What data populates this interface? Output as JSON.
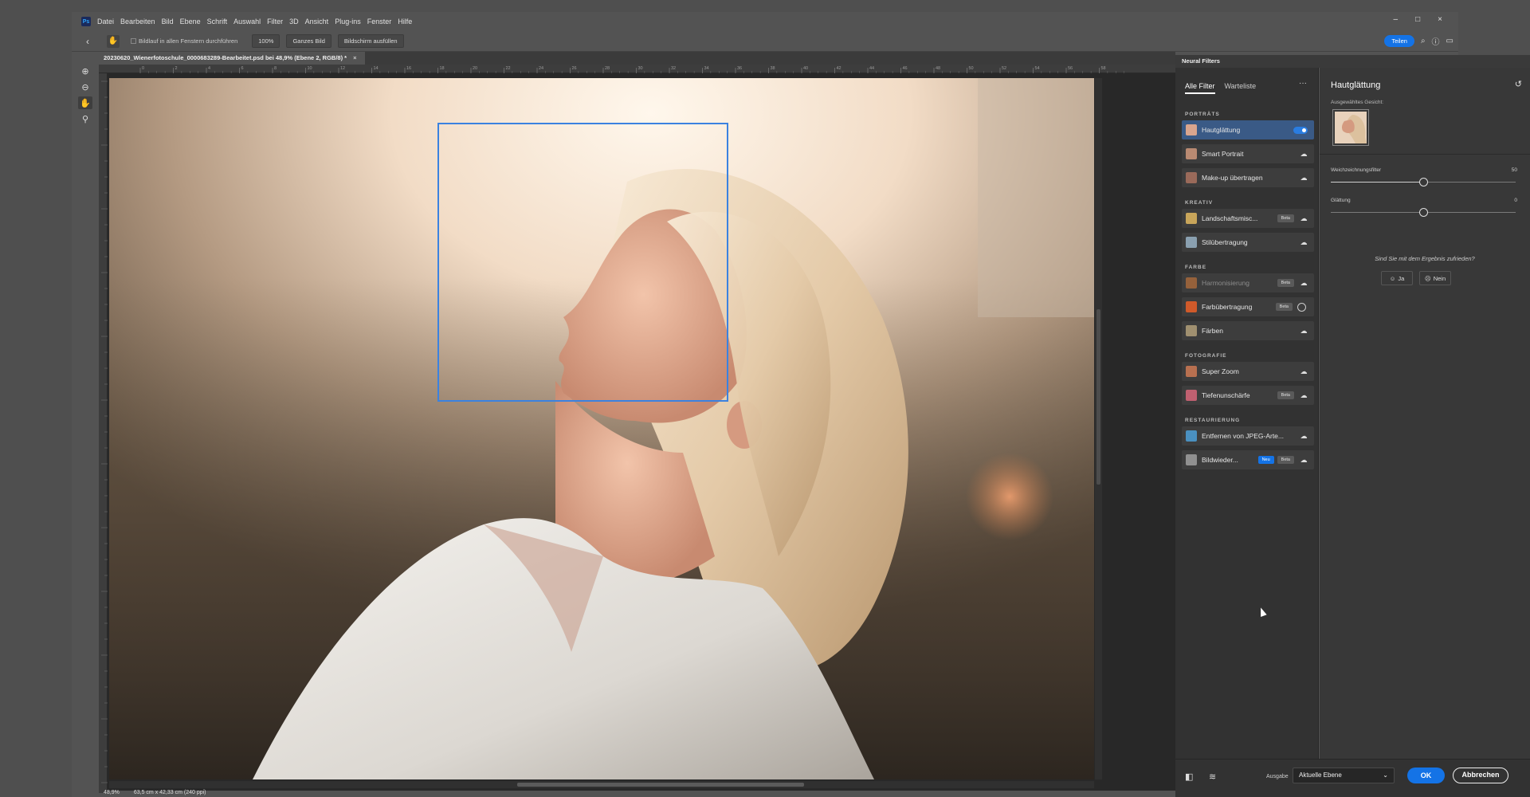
{
  "menu": {
    "logo": "Ps",
    "items": [
      "Datei",
      "Bearbeiten",
      "Bild",
      "Ebene",
      "Schrift",
      "Auswahl",
      "Filter",
      "3D",
      "Ansicht",
      "Plug-ins",
      "Fenster",
      "Hilfe"
    ]
  },
  "window_controls": {
    "minimize": "–",
    "maximize": "□",
    "close": "×"
  },
  "options": {
    "checkbox_label": "Bildlauf in allen Fenstern durchführen",
    "zoom_btn": "100%",
    "fit_btn": "Ganzes Bild",
    "fill_btn": "Bildschirm ausfüllen",
    "share": "Teilen"
  },
  "document": {
    "tab_title": "20230620_Wienerfotoschule_0000683289-Bearbeitet.psd bei 48,9% (Ebene 2, RGB/8) *",
    "tab_close": "×",
    "ruler_ticks": [
      "0",
      "2",
      "4",
      "6",
      "8",
      "10",
      "12",
      "14",
      "16",
      "18",
      "20",
      "22",
      "24",
      "26",
      "28",
      "30",
      "32",
      "34",
      "36",
      "38",
      "40",
      "42",
      "44",
      "46",
      "48",
      "50",
      "52",
      "54",
      "56",
      "58"
    ],
    "status_zoom": "48,9%",
    "status_info": "63,5 cm x 42,33 cm (240 ppi)"
  },
  "neural": {
    "panel_title": "Neural Filters",
    "tabs": [
      "Alle Filter",
      "Warteliste"
    ],
    "more": "···",
    "categories": [
      "PORTRÄTS",
      "KREATIV",
      "FARBE",
      "FOTOGRAFIE",
      "RESTAURIERUNG"
    ],
    "filters": [
      {
        "label": "Hautglättung",
        "thumb": "#d9a58e"
      },
      {
        "label": "Smart Portrait",
        "thumb": "#b98a72"
      },
      {
        "label": "Make-up übertragen",
        "thumb": "#9a6a5a"
      },
      {
        "label": "Landschaftsmisc...",
        "badge": "Beta",
        "thumb": "#c8a55a"
      },
      {
        "label": "Stilübertragung",
        "thumb": "#8aa0b0"
      },
      {
        "label": "Harmonisierung",
        "badge": "Beta",
        "thumb": "#d07a3a"
      },
      {
        "label": "Farbübertragung",
        "badge": "Beta",
        "thumb": "#d05a2a"
      },
      {
        "label": "Färben",
        "thumb": "#a09070"
      },
      {
        "label": "Super Zoom",
        "thumb": "#b87050"
      },
      {
        "label": "Tiefenunschärfe",
        "badge": "Beta",
        "thumb": "#c06070"
      },
      {
        "label": "Entfernen von JPEG-Arte...",
        "thumb": "#4a90c0"
      },
      {
        "label": "Bildwieder...",
        "badge_new": "Neu",
        "badge": "Beta",
        "thumb": "#909090"
      }
    ],
    "settings": {
      "title": "Hautglättung",
      "selected_face_label": "Ausgewähltes Gesicht:",
      "slider1_label": "Weichzeichnungsfilter",
      "slider1_value": "50",
      "slider1_fraction": 0.5,
      "slider2_label": "Glättung",
      "slider2_value": "0",
      "slider2_fraction": 0.5,
      "question": "Sind Sie mit dem Ergebnis zufrieden?",
      "yes": "Ja",
      "no": "Nein"
    },
    "bottom": {
      "output_label": "Ausgabe",
      "output_value": "Aktuelle Ebene",
      "ok": "OK",
      "cancel": "Abbrechen"
    }
  }
}
